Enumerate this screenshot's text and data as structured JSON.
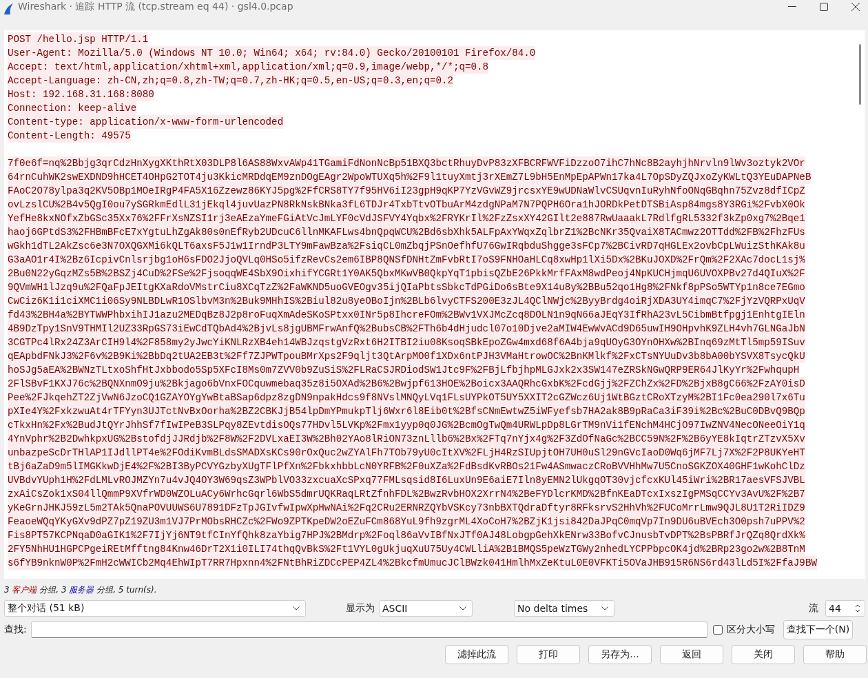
{
  "window": {
    "title": "Wireshark · 追踪 HTTP 流 (tcp.stream eq 44) · gsl4.0.pcap"
  },
  "stream": {
    "segments": [
      {
        "kind": "client",
        "lines": [
          "POST /hello.jsp HTTP/1.1",
          "User-Agent: Mozilla/5.0 (Windows NT 10.0; Win64; x64; rv:84.0) Gecko/20100101 Firefox/84.0",
          "Accept: text/html,application/xhtml+xml,application/xml;q=0.9,image/webp,*/*;q=0.8",
          "Accept-Language: zh-CN,zh;q=0.8,zh-TW;q=0.7,zh-HK;q=0.5,en-US;q=0.3,en;q=0.2",
          "Host: 192.168.31.168:8080",
          "Connection: keep-alive",
          "Content-type: application/x-www-form-urlencoded",
          "Content-Length: 49575"
        ]
      },
      {
        "kind": "client",
        "lines": [
          "7f0e6f=nq%2Bbjg3qrCdzHnXygXKthRtX03DLP8l6AS88WxvAWp41TGamiFdNonNcBp51BXQ3bctRhuyDvP83zXFBCRFWVFiDzzoO7ihC7hNc8B2ayhjhNrvln9lWv3oztyk2VOr",
          "64rnCuhWK2swEXDND9hHCET4OHpG2TOT4ju3KkicMRDdqEM9znDOgEAgr2WpoWTUXq5h%2F9l1tuyXmtj3rXEmZ7L9bH5EnMpEpAPWn17ka4L7OpSDyZQJxoZyKWLtQ3YEuDAPNeB",
          "FAoC2O78ylpa3q2KV5OBp1MOeIRgP4FA5X16Zzewz86KYJ5pg%2FfCRS8TY7f95HV6iI23gpH9qKP7YzVGvWZ9jrcsxYE9wUDNaWlvCSUqvnIuRyhNfoONqGBqhn75Zvz8dfICpZ",
          "ovLzslCU%2B4v5QgI0ou7ySGRkmEdlL31jEkql4juvUazPN8RkNskBNka3fL6TDJr4TxbTtvOTbuArM4zdgNPaM7N7PQPH6Ora1hJORDkPetDTSBiAsp84mgs8Y3RGi%2FvbX0Ok",
          "YefHe8kxNOfxZbGSc35Xx76%2FFrXsNZSI1rj3eAEzaYmeFGiAtVcJmLYF0cVdJSFVY4Yqbx%2FRYKrIl%2FzZsxXY42GIlt2e887RwUaaakL7RdlfgRL5332f3kZp0xg7%2Bqe1",
          "haoj6GPtdS3%2FHBmBFcE7xYgtuLhZgAk80s0nEfRyb2UDcuC6llnMKAFLws4bnQpqWCU%2Bd6sbXhk5ALFpAxYWqxZqlbrZ1%2BcNKr35QvaiX8TACmwz2OTTdd%2FB%2FhzFUs",
          "wGkh1dTL2AkZsc6e3N7OXQGXMi6kQLT6axsF5J1w1IrndP3LTY9mFawBza%2FsiqCL0mZbqjPSnOefhfU76GwIRqbduShgge3sFCp7%2BCivRD7qHGLEx2ovbCpLWuizSthKAk8u",
          "G3aAO1r4I%2Bz6IcpivCnlsrjbg1oH6sFDO2JjoQVLq0HSo5ifzRevCs2em6IBP8QNSfDNHtZmFvbRtI7oS9FNHOaHLCq8xwHp1lXi5Dx%2BKuJOXD%2FrQm%2F2XAc7docL1sj%",
          "2Bu0N22yGqzMZs5B%2BSZj4CuD%2FSe%2FjsoqqWE4SbX9OixhifYCGRt1Y0AK5QbxMKwVB0QkpYqT1pbisQZbE26PkkMrfFAxM8wdPeoj4NpKUCHjmqU6UVOXPBv27d4QIuX%2F",
          "9QVmWH1lJzq9u%2FQaFpJEItgKXaRdoVMstrCiu8XCqTzZ%2FaWKND5uoGVEOgv35ijQIaPbtsSbkcTdPGiDo6sBte9X14u8y%2BBu52qo1Hg8%2FNkf8pPSo5WTYp1n8ce7EGmo",
          "CwCiz6K1i1ciXMC1i06Sy9NLBDLwR1OSlbvM3n%2Buk9MHhIS%2Biul82u8yeOBoIjn%2BLb6lvyCTFS200E3zJL4QClNWjc%2ByyBrdg4oiRjXDA3UY4imqC7%2FjYzVQRPxUqV",
          "fd43%2BH4a%2BYTWWPhbxihIJ1azu2MEDqBz8J2p8roFuqXmAdeSKoSPtxx0INr5p8IhcreFOm%2BWv1VXJMcZcq8DOLN1n9qN66aJEqY3IfRhA23vL5CibmBtfpgj1EnhtgIEln",
          "4B9DzTpy1SnV9THMIl2UZ33RpGS73iEwCdTQbAd4%2BjvLs8jgUBMFrwAnfQ%2BubsCB%2FTh6b4dHjudcl07o10Djve2aMIW4EwWvACd9D65uwIH9OHpvhK9ZLH4vh7GLNGaJbN",
          "3CGTPc4lRx24Z3ArCIH9l4%2F858my2yJwcYiKNLRzXB4eh14WBJzqstgVzRxt6H2ITBI2iu08KsoqSBkEpoZGw4mxd68f6A4bja9qUOyG3OYnOHXw%2BInq69zMtTl5mp59ISuv",
          "qEApbdFNkJ3%2F6v%2B9Ki%2BbDq2tUA2EB3t%2Ff7ZJPWTpouBMrXps2F9qljt3QtArpMO0f1XDx6ntPJH3VMaHtrowOC%2BnKMlkf%2FxCTsNYUuDv3b8bA00bYSVX8TsycQkU",
          "hoSJg5aEA%2BWNzTLtxoShfHtJxbbodo5Sp5XFcI8Ms0m7ZVV0b9ZuSiS%2FLRaCSJRDiodSW1Jtc9F%2FBjLfbjhpMLGJxk2x3SW147eZRSkNGwQRP9ER64JlKyYr%2FwhqupH",
          "2FlSBvF1KXJ76c%2BQNXnmO9ju%2Bkjago6bVnxFOCquwmebaq35z8i5OXAd%2B6%2Bwjpf613HOE%2Boicx3AAQRhcGxbK%2FcdGjj%2FZChZx%2FD%2BjxB8gC66%2FzAY0isD",
          "Pee%2FJkqehZT2ZjVwN6JzoCQ1GZAYOYgYwBtaBSap6dpz8zgDN9npakHdcs9f8NVslMNQyLVq1FLsUYPkOT5UY5XXIT2cGZWcz6Uj1WtBGztCRoXTzyM%2BI1Fc0ea290l7x6Tu",
          "pXIe4Y%2FxkzwuAt4rTFYyn3UJTctNvBxOorha%2BZ2CBKJjB54lpDmYPmukpTlj6Wxr6l8Eib0t%2BfsCNmEwtwZ5iWFyefsb7HA2ak8B9pRaCa3iF39i%2Bc%2BuC0DBvQ9BQp",
          "cTkxHn%2Fx%2BudJtQYrJhhSf7fIwIPeB3SLPqy8ZEvtdisOQs77HDvl5LVKp%2Fmx1yyp0q0JG%2BcmOgTwQm4URWLpDp8LGrTM9nVi1fENchM4HCjO97IwZNV4NecONeeOiY1q",
          "4YnVphr%2B2DwhkpxUG%2BstofdjJJRdjb%2F8W%2F2DVLxaEI3W%2Bh02YAo8lRiON73znLllb6%2Bx%2FTq7nYjx4g%2F3ZdOfNaGc%2BCC59N%2F%2B6yYE8kIqtrZTzvX5Xv",
          "unbazpeScDrTHlAP1IJdllPT4e%2FOdiKvmBLdsSMADXsKCs90rOxQuc2wZYAlFh7TOb79yU0cItXV%2FLjH4RzSIUpjtOH7UH0uSl29nGVcIaoD0Wq6jMF7Lj7X%2F2P8UKYeHT",
          "tBj6aZaD9m5lIMGKkwDjE4%2F%2BI3ByPCVYGzbyXUgTFlPfXn%2FbkxhbbLcN0YRFB%2F0uXZa%2FdBsdKvRBOs21Fw4ASmwaczCRoBVVHhMw7U5CnoSGKZOX40GHF1wKohClDz",
          "UVBdvYUph1H%2FdLMLvROJMZYn7u4vJQ4OY3W69qsZ3WPblVO33zxcuaXcSPxq77FMLsqsid8I6LuxUn9E6aiE7Iln8yEMN2lUkgqOT30vjcfcxKUl45iWri%2BR17aesVFSJVBL",
          "zxAiCsZok1xS04llQmmP9XVfrWD0WZOLuACy6WrhcGqrl6WbS5dmrUQKRaqLRtZfnhFDL%2BwzRvbHOX2XrrN4%2BeFYDlcrKMD%2BfnKEaDTcxIxszIgPMSqCCYv3AvU%2F%2B7",
          "yKeGrnJHKJ59zL5m2TAk5QnaPOVUUWS6U7891DFzTpJGIvfwIpwXpHwNAi%2Fq2CRu2ERNRZQYbVSKcy73nbBXTQdraDftyr8RFksrvS2HhVh%2FUCoMrrLmw9QJL8U1T2RiIDZ9",
          "FeaoeWQqYKyGXv9dPZ7pZ19ZU3m1VJ7PrMObsRHCZc%2FWo9ZPTKpeDW2oEZuFCm868YuL9fh9zgrML4XoCoH7%2BZjK1jsi842DaJPqC0mqVp7In9DU6uBVEch3O0psh7uPPV%2",
          "Fis8PT57KCPNqaD0aGIK1%2F7IjYj6NT9tfCInYfQhk8zaYbig7HPJ%2BMdrp%2Foql86aVvIBfNxJTf0AJ48LobgpGehXkENrw33BofvCJnusbTvDPT%2BsPBRfJrQZq8QrdXk%",
          "2FY5NhHU1HGPCPgeiREtMfftng84Knw46DrT2X1i0ILI74thqQvBkS%2Ft1VYL0gUkjuqXuU75Uy4CWLliA%2B1BMQS5peWzTGWy2nhedLYCPPbpcOK4jd%2BRp23go2w%2B8TnM",
          "s6fYB9nknW0P%2FmH2cWWICb2Mq4EhWIpT7RR7Hpxnn4%2FNtBhRiZDCcPEP4ZL4%2BkcfmUmucJClBWzk041HmlhMxZeKtuL0E0VFKTi5OVaJHB915R6NS6rd43lLd5I%2FfaJ9BW"
        ]
      }
    ]
  },
  "summary": [
    {
      "kind": "plain",
      "text": "3 "
    },
    {
      "kind": "client",
      "text": "客户端"
    },
    {
      "kind": "plain",
      "text": " 分组, 3 "
    },
    {
      "kind": "server",
      "text": "服务器"
    },
    {
      "kind": "plain",
      "text": " 分组, 5 turn(s)."
    }
  ],
  "controls": {
    "conversation": "整个对话 (51 kB)",
    "show_as_label": "显示为",
    "show_as": "ASCII",
    "delta": "No delta times",
    "stream_label": "流",
    "stream": "44"
  },
  "find": {
    "label": "查找:",
    "case_label": "区分大小写",
    "case_sensitive": false,
    "next_button": "查找下一个(N)"
  },
  "buttons": [
    "滤掉此流",
    "打印",
    "另存为...",
    "返回",
    "关闭",
    "帮助"
  ]
}
